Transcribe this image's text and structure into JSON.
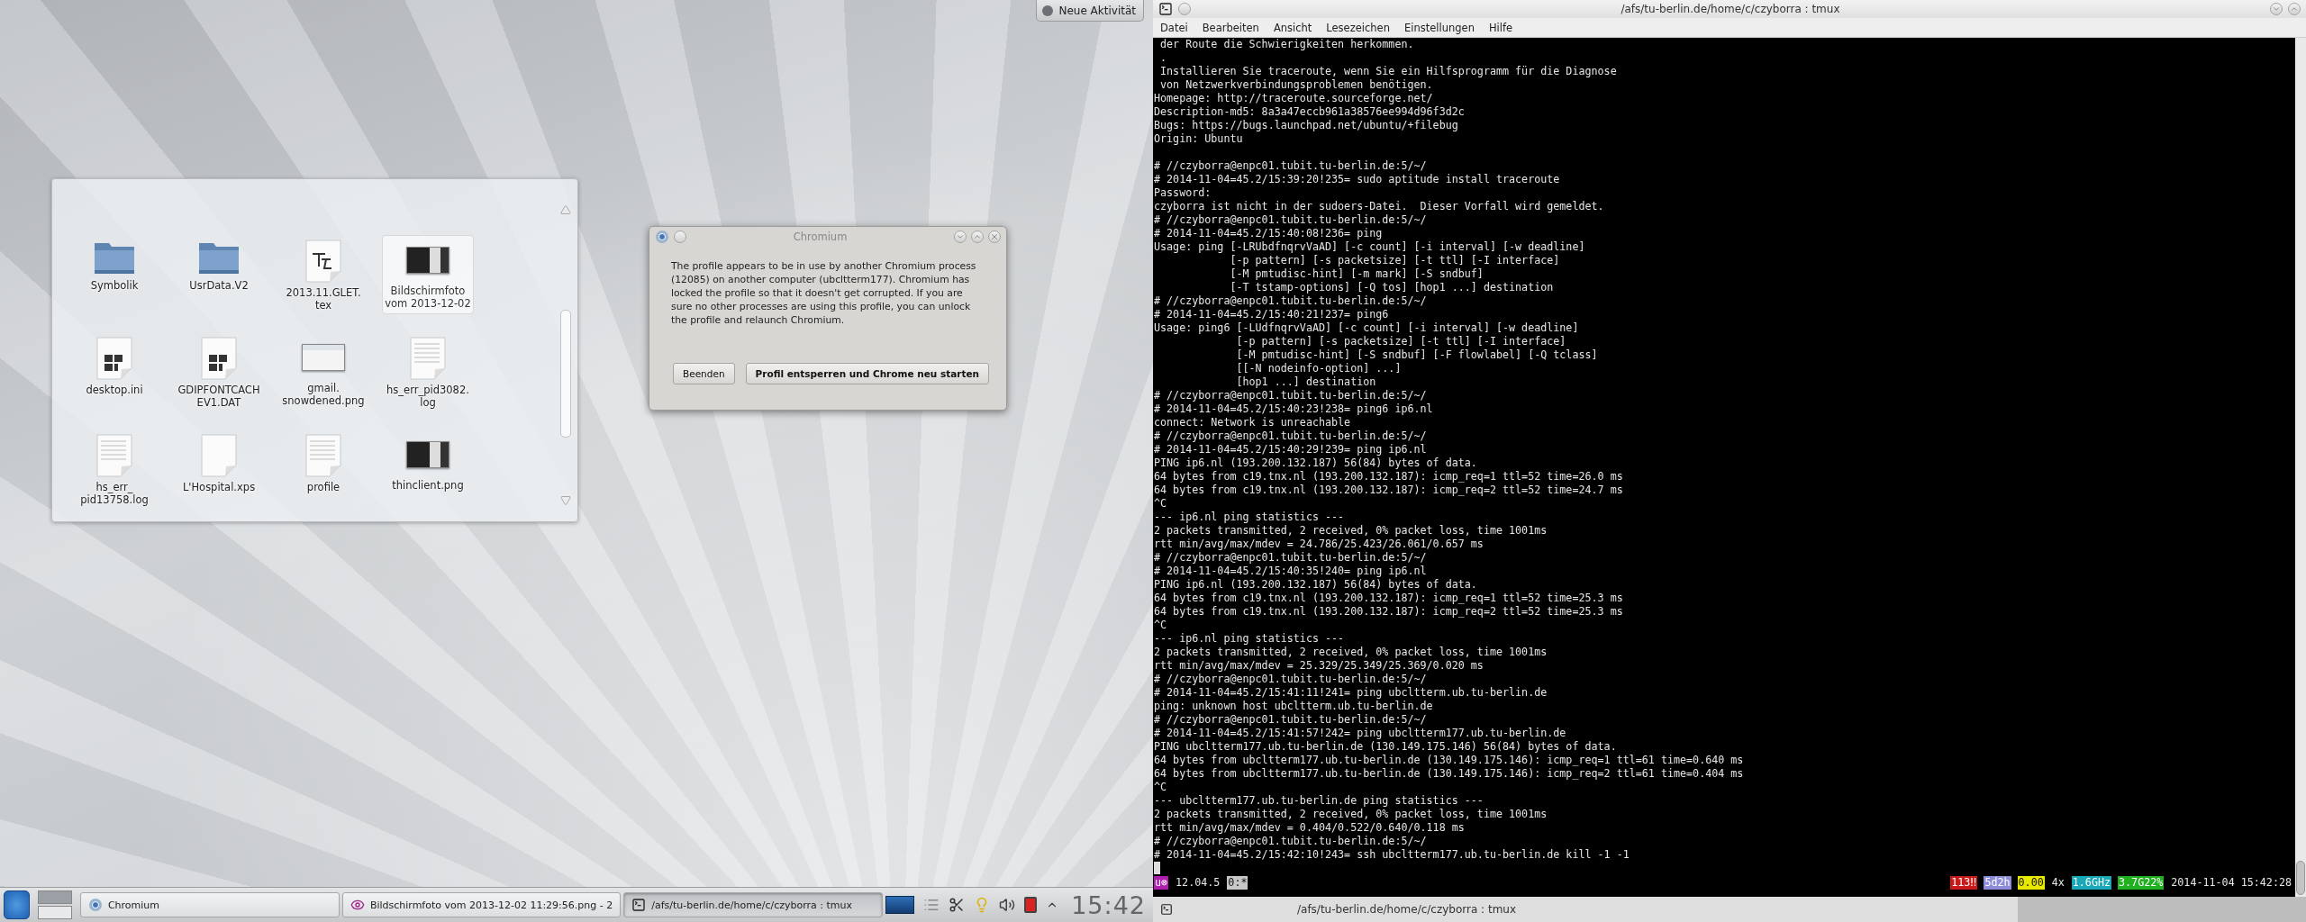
{
  "desktop": {
    "activity_button": "Neue Aktivität",
    "folder_view": {
      "items": [
        {
          "kind": "folder",
          "label_lines": [
            "Symbolik"
          ],
          "selected": false
        },
        {
          "kind": "folder",
          "label_lines": [
            "UsrData.V2"
          ],
          "selected": false
        },
        {
          "kind": "tex",
          "label_lines": [
            "2013.11.GLET.",
            "tex"
          ],
          "selected": false
        },
        {
          "kind": "dark-image",
          "label_lines": [
            "Bildschirmfoto",
            "vom 2013-12-02"
          ],
          "selected": true
        },
        {
          "kind": "ini",
          "label_lines": [
            "desktop.ini"
          ],
          "selected": false
        },
        {
          "kind": "ini",
          "label_lines": [
            "GDIPFONTCACH",
            "EV1.DAT"
          ],
          "selected": false
        },
        {
          "kind": "light-image",
          "label_lines": [
            "gmail.",
            "snowdened.png"
          ],
          "selected": false
        },
        {
          "kind": "log",
          "label_lines": [
            "hs_err_pid3082.",
            "log"
          ],
          "selected": false
        },
        {
          "kind": "log",
          "label_lines": [
            "hs_err_",
            "pid13758.log"
          ],
          "selected": false
        },
        {
          "kind": "blank",
          "label_lines": [
            "L'Hospital.xps"
          ],
          "selected": false
        },
        {
          "kind": "txt",
          "label_lines": [
            "profile"
          ],
          "selected": false
        },
        {
          "kind": "dark-image",
          "label_lines": [
            "thinclient.png"
          ],
          "selected": false
        }
      ]
    },
    "dialog": {
      "title": "Chromium",
      "message": "The profile appears to be in use by another Chromium process (12085) on another computer (ubcltterm177). Chromium has locked the profile so that it doesn't get corrupted. If you are sure no other processes are using this profile, you can unlock the profile and relaunch Chromium.",
      "buttons": [
        {
          "label": "Beenden",
          "default": false
        },
        {
          "label": "Profil entsperren und Chrome neu starten",
          "default": true
        }
      ]
    },
    "taskbar": {
      "tasks": [
        {
          "kind": "browser",
          "label": "Chromium",
          "selected": false
        },
        {
          "kind": "image",
          "label": "Bildschirmfoto vom 2013-12-02 11:29:56.png - 2",
          "selected": false
        },
        {
          "kind": "terminal",
          "label": "/afs/tu-berlin.de/home/c/czyborra : tmux",
          "selected": true
        }
      ],
      "clock": "15:42"
    }
  },
  "terminal": {
    "title": "/afs/tu-berlin.de/home/c/czyborra : tmux",
    "menu": [
      "Datei",
      "Bearbeiten",
      "Ansicht",
      "Lesezeichen",
      "Einstellungen",
      "Hilfe"
    ],
    "blocks": [
      [
        " der Route die Schwierigkeiten herkommen.",
        " .",
        " Installieren Sie traceroute, wenn Sie ein Hilfsprogramm für die Diagnose",
        " von Netzwerkverbindungsproblemen benötigen.",
        "Homepage: http://traceroute.sourceforge.net/",
        "Description-md5: 8a3a47eccb961a38576ee994d96f3d2c",
        "Bugs: https://bugs.launchpad.net/ubuntu/+filebug",
        "Origin: Ubuntu"
      ],
      [
        "# //czyborra@enpc01.tubit.tu-berlin.de:5/~/",
        "# 2014-11-04=45.2/15:39:20!235= sudo aptitude install traceroute",
        "Password:",
        "czyborra ist nicht in der sudoers-Datei.  Dieser Vorfall wird gemeldet.",
        "# //czyborra@enpc01.tubit.tu-berlin.de:5/~/",
        "# 2014-11-04=45.2/15:40:08!236= ping",
        "Usage: ping [-LRUbdfnqrvVaAD] [-c count] [-i interval] [-w deadline]",
        "            [-p pattern] [-s packetsize] [-t ttl] [-I interface]",
        "            [-M pmtudisc-hint] [-m mark] [-S sndbuf]",
        "            [-T tstamp-options] [-Q tos] [hop1 ...] destination",
        "# //czyborra@enpc01.tubit.tu-berlin.de:5/~/",
        "# 2014-11-04=45.2/15:40:21!237= ping6",
        "Usage: ping6 [-LUdfnqrvVaAD] [-c count] [-i interval] [-w deadline]",
        "             [-p pattern] [-s packetsize] [-t ttl] [-I interface]",
        "             [-M pmtudisc-hint] [-S sndbuf] [-F flowlabel] [-Q tclass]",
        "             [[-N nodeinfo-option] ...]",
        "             [hop1 ...] destination",
        "# //czyborra@enpc01.tubit.tu-berlin.de:5/~/",
        "# 2014-11-04=45.2/15:40:23!238= ping6 ip6.nl",
        "connect: Network is unreachable",
        "# //czyborra@enpc01.tubit.tu-berlin.de:5/~/",
        "# 2014-11-04=45.2/15:40:29!239= ping ip6.nl",
        "PING ip6.nl (193.200.132.187) 56(84) bytes of data.",
        "64 bytes from c19.tnx.nl (193.200.132.187): icmp_req=1 ttl=52 time=26.0 ms",
        "64 bytes from c19.tnx.nl (193.200.132.187): icmp_req=2 ttl=52 time=24.7 ms",
        "^C",
        "--- ip6.nl ping statistics ---",
        "2 packets transmitted, 2 received, 0% packet loss, time 1001ms",
        "rtt min/avg/max/mdev = 24.786/25.423/26.061/0.657 ms",
        "# //czyborra@enpc01.tubit.tu-berlin.de:5/~/",
        "# 2014-11-04=45.2/15:40:35!240= ping ip6.nl",
        "PING ip6.nl (193.200.132.187) 56(84) bytes of data.",
        "64 bytes from c19.tnx.nl (193.200.132.187): icmp_req=1 ttl=52 time=25.3 ms",
        "64 bytes from c19.tnx.nl (193.200.132.187): icmp_req=2 ttl=52 time=25.3 ms",
        "^C",
        "--- ip6.nl ping statistics ---",
        "2 packets transmitted, 2 received, 0% packet loss, time 1001ms",
        "rtt min/avg/max/mdev = 25.329/25.349/25.369/0.020 ms",
        "# //czyborra@enpc01.tubit.tu-berlin.de:5/~/",
        "# 2014-11-04=45.2/15:41:11!241= ping ubcltterm.ub.tu-berlin.de",
        "ping: unknown host ubcltterm.ub.tu-berlin.de",
        "# //czyborra@enpc01.tubit.tu-berlin.de:5/~/",
        "# 2014-11-04=45.2/15:41:57!242= ping ubcltterm177.ub.tu-berlin.de",
        "PING ubcltterm177.ub.tu-berlin.de (130.149.175.146) 56(84) bytes of data.",
        "64 bytes from ubcltterm177.ub.tu-berlin.de (130.149.175.146): icmp_req=1 ttl=61 time=0.640 ms",
        "64 bytes from ubcltterm177.ub.tu-berlin.de (130.149.175.146): icmp_req=2 ttl=61 time=0.404 ms",
        "^C",
        "--- ubcltterm177.ub.tu-berlin.de ping statistics ---",
        "2 packets transmitted, 2 received, 0% packet loss, time 1001ms",
        "rtt min/avg/max/mdev = 0.404/0.522/0.640/0.118 ms",
        "# //czyborra@enpc01.tubit.tu-berlin.de:5/~/",
        "# 2014-11-04=45.2/15:42:10!243= ssh ubcltterm177.ub.tu-berlin.de kill -1 -1"
      ]
    ],
    "status_left": [
      {
        "text": "u⊗",
        "color": "#b01eb0"
      },
      {
        "text": "12.04.5"
      },
      {
        "text": "0:*",
        "color": "#c8c8c8"
      }
    ],
    "status_right": [
      {
        "text": "113‼",
        "color": "#c81a1a"
      },
      {
        "text": "5d2h",
        "color": "#8c8cd8"
      },
      {
        "text": "0.00",
        "color": "#e8e800"
      },
      {
        "text": "4x"
      },
      {
        "text": "1.6GHz",
        "color": "#18a8b8"
      },
      {
        "text": "3.7G22%",
        "color": "#20b020"
      },
      {
        "text": "2014-11-04 15:42:28"
      }
    ],
    "bottom_title": "/afs/tu-berlin.de/home/c/czyborra : tmux"
  }
}
